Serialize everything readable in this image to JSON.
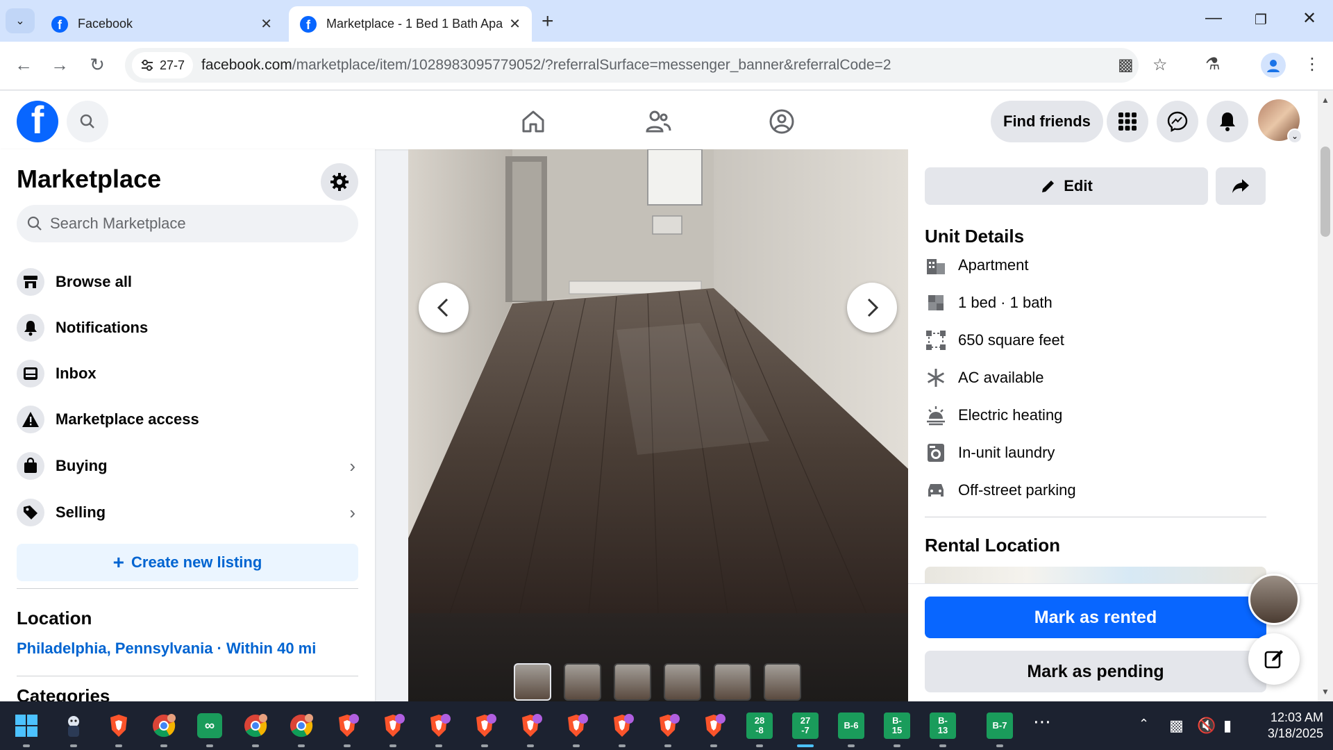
{
  "browser": {
    "tabs": [
      {
        "title": "Facebook",
        "active": false
      },
      {
        "title": "Marketplace - 1 Bed 1 Bath Apa",
        "active": true
      }
    ],
    "site_chip": "27-7",
    "url_host": "facebook.com",
    "url_path": "/marketplace/item/1028983095779052/?referralSurface=messenger_banner&referralCode=2"
  },
  "fb_header": {
    "find_friends_label": "Find friends"
  },
  "sidebar": {
    "title": "Marketplace",
    "search_placeholder": "Search Marketplace",
    "items": [
      {
        "label": "Browse all",
        "icon": "storefront-icon"
      },
      {
        "label": "Notifications",
        "icon": "bell-icon"
      },
      {
        "label": "Inbox",
        "icon": "inbox-icon"
      },
      {
        "label": "Marketplace access",
        "icon": "warning-icon"
      },
      {
        "label": "Buying",
        "icon": "shopping-bag-icon"
      },
      {
        "label": "Selling",
        "icon": "price-tag-icon"
      }
    ],
    "create_listing_label": "Create new listing",
    "location_heading": "Location",
    "location_value": "Philadelphia, Pennsylvania · Within 40 mi",
    "categories_heading": "Categories"
  },
  "listing": {
    "edit_label": "Edit",
    "unit_details_heading": "Unit Details",
    "details": [
      {
        "label": "Apartment",
        "icon": "building-icon"
      },
      {
        "label": "1 bed · 1 bath",
        "icon": "bed-icon"
      },
      {
        "label": "650 square feet",
        "icon": "area-icon"
      },
      {
        "label": "AC available",
        "icon": "snowflake-icon"
      },
      {
        "label": "Electric heating",
        "icon": "heating-icon"
      },
      {
        "label": "In-unit laundry",
        "icon": "washer-icon"
      },
      {
        "label": "Off-street parking",
        "icon": "car-icon"
      }
    ],
    "rental_location_heading": "Rental Location",
    "mark_rented_label": "Mark as rented",
    "mark_pending_label": "Mark as pending",
    "thumbnail_count": 6
  },
  "taskbar": {
    "apps": [
      {
        "label": "",
        "icon": "windows-start-icon"
      },
      {
        "label": "",
        "icon": "mascot-app-icon"
      },
      {
        "label": "",
        "icon": "brave-browser-icon"
      },
      {
        "label": "",
        "icon": "chrome-profile-icon"
      },
      {
        "label": "",
        "icon": "infinity-app-icon"
      },
      {
        "label": "",
        "icon": "chrome-profile-icon"
      },
      {
        "label": "",
        "icon": "chrome-profile-icon"
      },
      {
        "label": "",
        "icon": "brave-profile-icon"
      },
      {
        "label": "",
        "icon": "brave-profile-icon"
      },
      {
        "label": "",
        "icon": "brave-profile-icon"
      },
      {
        "label": "",
        "icon": "brave-profile-icon"
      },
      {
        "label": "",
        "icon": "brave-profile-icon"
      },
      {
        "label": "",
        "icon": "brave-profile-icon"
      },
      {
        "label": "",
        "icon": "brave-profile-icon"
      },
      {
        "label": "",
        "icon": "brave-profile-icon"
      },
      {
        "label": "",
        "icon": "brave-profile-icon"
      },
      {
        "label": "28\n-8",
        "icon": "green-tile-icon"
      },
      {
        "label": "27\n-7",
        "icon": "green-tile-icon"
      },
      {
        "label": "B-6",
        "icon": "green-tile-icon"
      },
      {
        "label": "B-\n15",
        "icon": "green-tile-icon"
      },
      {
        "label": "B-\n13",
        "icon": "green-tile-icon"
      },
      {
        "label": "B-7",
        "icon": "green-tile-icon"
      }
    ],
    "time": "12:03 AM",
    "date": "3/18/2025"
  },
  "colors": {
    "fb_blue": "#0866ff",
    "link_blue": "#0064d1",
    "taskbar_bg": "#1c2230",
    "tab_strip": "#d3e3fd",
    "green_tile": "#1a9c5b"
  }
}
